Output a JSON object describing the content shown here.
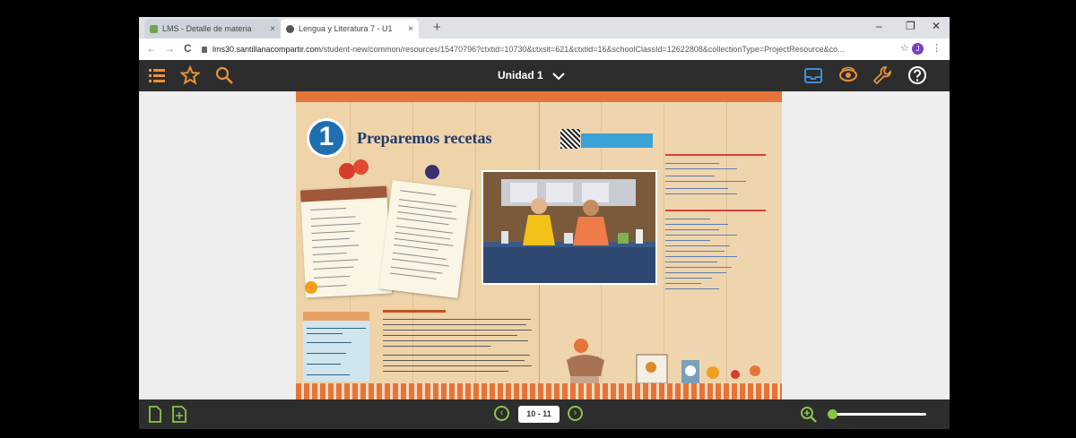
{
  "browser": {
    "tabs": [
      {
        "title": "LMS - Detalle de materia",
        "close": "×",
        "active": false
      },
      {
        "title": "Lengua y Literatura 7 - U1",
        "close": "×",
        "active": true
      }
    ],
    "new_tab": "+",
    "window_controls": {
      "minimize": "–",
      "maximize": "❐",
      "close": "✕"
    },
    "nav": {
      "back": "←",
      "forward": "→",
      "reload": "C"
    },
    "url": {
      "host": "lms30.santillanacompartir.com",
      "path": "/student-new/common/resources/15470796?ctxtid=10730&ctxsit=621&ctxtid=16&schoolClassId=12622808&collectionType=ProjectResource&co..."
    },
    "bookmark_star": "☆",
    "profile_initial": "J",
    "menu": "⋮"
  },
  "app": {
    "unit_label": "Unidad 1",
    "icons_left": [
      "list-icon",
      "star-icon",
      "search-icon"
    ],
    "icons_right": [
      "inbox-icon",
      "eye-icon",
      "wrench-icon",
      "help-icon"
    ],
    "page_indicator": "10 - 11",
    "colors": {
      "toolbar_bg": "#2d2d2d",
      "accent_orange": "#e5743a",
      "accent_green": "#8bc34a",
      "accent_blue": "#1e6fb0"
    }
  },
  "book": {
    "unit_number": "1",
    "title": "Preparemos recetas"
  }
}
